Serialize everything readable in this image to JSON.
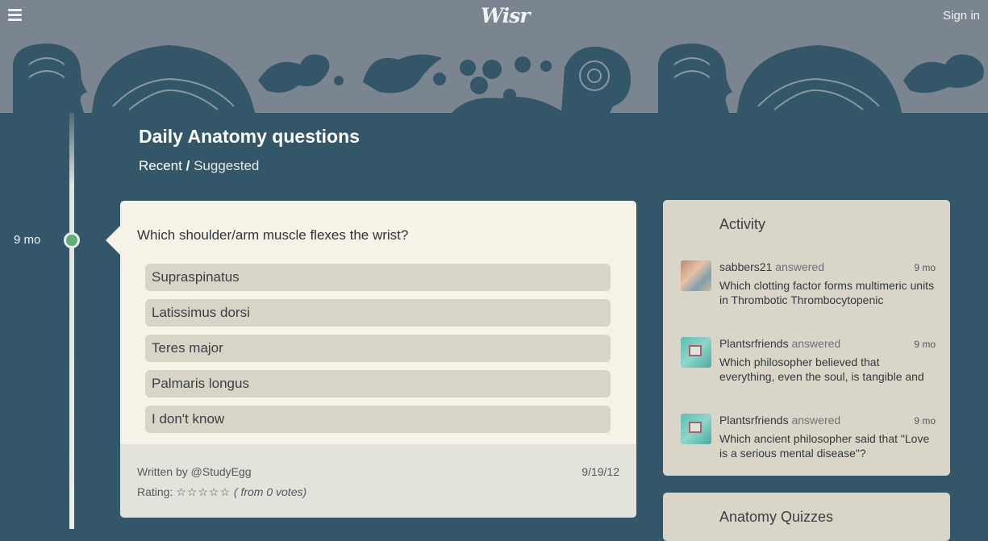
{
  "header": {
    "logo_text": "Wisr",
    "signin_label": "Sign in",
    "menu_icon": "hamburger-icon"
  },
  "timeline": {
    "age_label": "9 mo"
  },
  "page": {
    "title": "Daily Anatomy questions",
    "tab_recent": "Recent",
    "tab_separator": "/",
    "tab_suggested": "Suggested"
  },
  "question_card": {
    "question": "Which shoulder/arm muscle flexes the wrist?",
    "answers": [
      "Supraspinatus",
      "Latissimus dorsi",
      "Teres major",
      "Palmaris longus",
      "I don't know"
    ],
    "written_by": "Written by @StudyEgg",
    "date": "9/19/12",
    "rating_label": "Rating:",
    "stars": "☆☆☆☆☆",
    "votes": "( from 0 votes)"
  },
  "activity": {
    "title": "Activity",
    "items": [
      {
        "user": "sabbers21",
        "verb": "answered",
        "time": "9 mo",
        "text": "Which clotting factor forms multimeric units in Thrombotic Thrombocytopenic"
      },
      {
        "user": "Plantsrfriends",
        "verb": "answered",
        "time": "9 mo",
        "text": "Which philosopher believed that everything, even the soul, is tangible and"
      },
      {
        "user": "Plantsrfriends",
        "verb": "answered",
        "time": "9 mo",
        "text": "Which ancient philosopher said that \"Love is a serious mental disease\"?"
      }
    ]
  },
  "quizzes": {
    "title": "Anatomy Quizzes"
  },
  "colors": {
    "background": "#335768",
    "topbar": "#7a8590",
    "card": "#f7f2e8",
    "answer": "#d8d4c7",
    "sidebar_card": "#d9d5c9",
    "timeline_dot": "#5fae74"
  }
}
